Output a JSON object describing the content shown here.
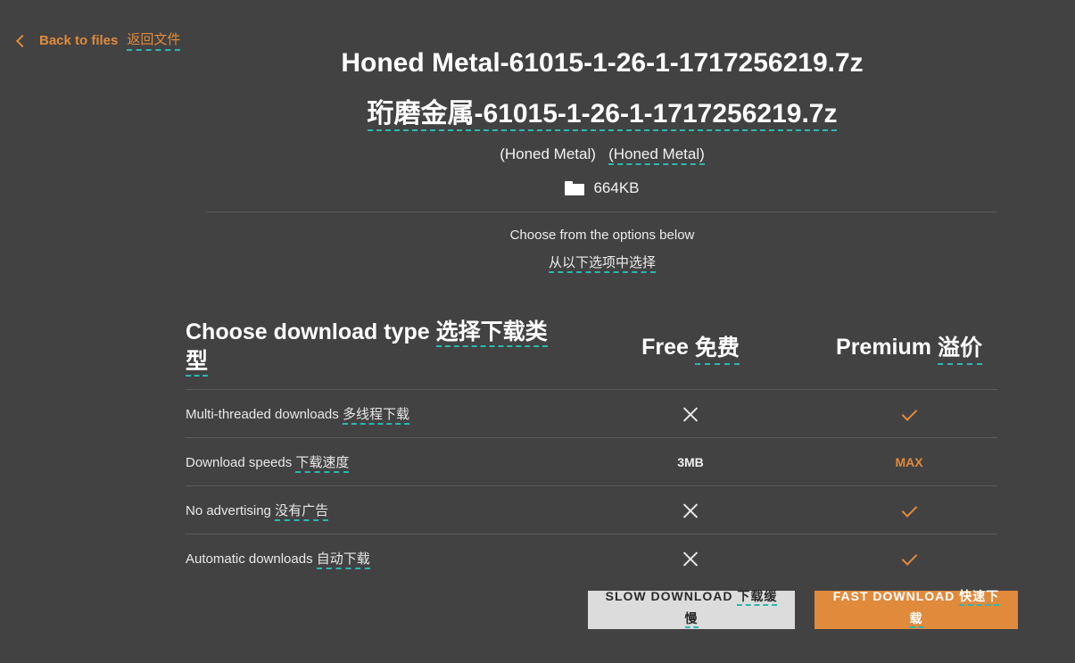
{
  "back": {
    "label_en": "Back to files",
    "label_zh": "返回文件"
  },
  "file": {
    "title_en": "Honed Metal-61015-1-26-1-1717256219.7z",
    "title_zh_prefix": "珩磨金属",
    "title_zh_suffix": "-61015-1-26-1-1717256219.7z",
    "name_en": "(Honed Metal)",
    "name_zh": "(Honed Metal)",
    "size": "664KB"
  },
  "choose": {
    "en": "Choose from the options below",
    "zh": "从以下选项中选择"
  },
  "table": {
    "header_type_en": "Choose download type",
    "header_type_zh": "选择下载类型",
    "header_free_en": "Free",
    "header_free_zh": "免费",
    "header_premium_en": "Premium",
    "header_premium_zh": "溢价",
    "rows": [
      {
        "en": "Multi-threaded downloads",
        "zh": "多线程下载",
        "free": "x-icon",
        "premium": "check-icon"
      },
      {
        "en": "Download speeds",
        "zh": "下载速度",
        "free": "3MB",
        "premium": "MAX"
      },
      {
        "en": "No advertising",
        "zh": "没有广告",
        "free": "x-icon",
        "premium": "check-icon"
      },
      {
        "en": "Automatic downloads",
        "zh": "自动下载",
        "free": "x-icon",
        "premium": "check-icon"
      }
    ]
  },
  "buttons": {
    "slow_en": "SLOW DOWNLOAD",
    "slow_zh": "下载缓慢",
    "fast_en": "FAST DOWNLOAD",
    "fast_zh": "快速下载"
  },
  "colors": {
    "background": "#424242",
    "accent": "#e08a3c",
    "dashed_underline": "#2bb8b0"
  }
}
